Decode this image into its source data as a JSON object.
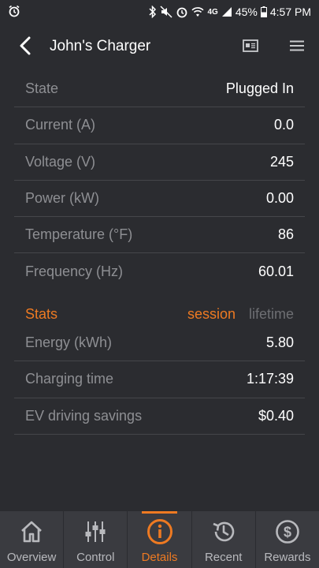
{
  "status_bar": {
    "battery_percent": "45%",
    "time": "4:57 PM",
    "network": "4G"
  },
  "header": {
    "title": "John's Charger"
  },
  "details": [
    {
      "label": "State",
      "value": "Plugged In"
    },
    {
      "label": "Current (A)",
      "value": "0.0"
    },
    {
      "label": "Voltage (V)",
      "value": "245"
    },
    {
      "label": "Power (kW)",
      "value": "0.00"
    },
    {
      "label": "Temperature (°F)",
      "value": "86"
    },
    {
      "label": "Frequency (Hz)",
      "value": "60.01"
    }
  ],
  "stats": {
    "title": "Stats",
    "tabs": [
      {
        "label": "session",
        "active": true
      },
      {
        "label": "lifetime",
        "active": false
      }
    ],
    "rows": [
      {
        "label": "Energy (kWh)",
        "value": "5.80"
      },
      {
        "label": "Charging time",
        "value": "1:17:39"
      },
      {
        "label": "EV driving savings",
        "value": "$0.40"
      }
    ]
  },
  "bottom_nav": [
    {
      "label": "Overview",
      "icon": "home-icon",
      "active": false
    },
    {
      "label": "Control",
      "icon": "sliders-icon",
      "active": false
    },
    {
      "label": "Details",
      "icon": "info-icon",
      "active": true
    },
    {
      "label": "Recent",
      "icon": "history-icon",
      "active": false
    },
    {
      "label": "Rewards",
      "icon": "dollar-icon",
      "active": false
    }
  ],
  "colors": {
    "background": "#2b2c30",
    "accent": "#ee7a22",
    "label": "#8e8f93",
    "nav_background": "#3a3b40"
  }
}
